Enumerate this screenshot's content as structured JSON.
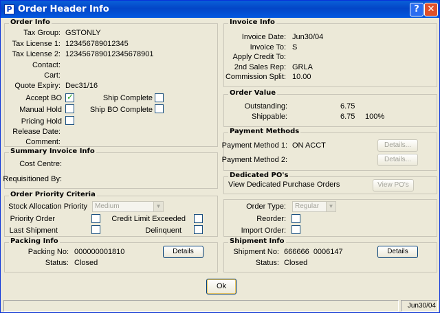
{
  "window": {
    "title": "Order Header Info",
    "app_icon": "P",
    "help_label": "?",
    "close_label": "✕"
  },
  "order_info": {
    "title": "Order Info",
    "tax_group_label": "Tax Group:",
    "tax_group": "GSTONLY",
    "tax_license1_label": "Tax License 1:",
    "tax_license1": "123456789012345",
    "tax_license2_label": "Tax License 2:",
    "tax_license2": "123456789012345678901",
    "contact_label": "Contact:",
    "cart_label": "Cart:",
    "quote_expiry_label": "Quote Expiry:",
    "quote_expiry": "Dec31/16",
    "accept_bo_label": "Accept BO",
    "accept_bo": true,
    "ship_complete_label": "Ship Complete",
    "ship_complete": false,
    "manual_hold_label": "Manual Hold",
    "manual_hold": false,
    "ship_bo_complete_label": "Ship BO Complete",
    "ship_bo_complete": false,
    "pricing_hold_label": "Pricing Hold",
    "pricing_hold": false,
    "release_date_label": "Release Date:",
    "comment_label": "Comment:"
  },
  "summary_invoice": {
    "title": "Summary Invoice Info",
    "cost_centre_label": "Cost Centre:",
    "requisitioned_label": "Requisitioned By:"
  },
  "priority": {
    "title": "Order Priority Criteria",
    "stock_alloc_label": "Stock Allocation Priority",
    "stock_alloc_value": "Medium",
    "priority_order_label": "Priority Order",
    "credit_limit_label": "Credit Limit Exceeded",
    "last_shipment_label": "Last Shipment",
    "delinquent_label": "Delinquent"
  },
  "packing": {
    "title": "Packing Info",
    "packing_no_label": "Packing No:",
    "packing_no": "000000001810",
    "status_label": "Status:",
    "status": "Closed",
    "details_label": "Details"
  },
  "invoice_info": {
    "title": "Invoice Info",
    "invoice_date_label": "Invoice Date:",
    "invoice_date": "Jun30/04",
    "invoice_to_label": "Invoice To:",
    "invoice_to": "S",
    "apply_credit_label": "Apply Credit To:",
    "sales_rep_label": "2nd Sales Rep:",
    "sales_rep": "GRLA",
    "commission_label": "Commission Split:",
    "commission": "10.00"
  },
  "order_value": {
    "title": "Order Value",
    "outstanding_label": "Outstanding:",
    "outstanding": "6.75",
    "shippable_label": "Shippable:",
    "shippable": "6.75",
    "shippable_pct": "100%"
  },
  "payment": {
    "title": "Payment Methods",
    "method1_label": "Payment Method 1:",
    "method1": "ON ACCT",
    "method2_label": "Payment Method 2:",
    "details_label": "Details..."
  },
  "dedicated_po": {
    "title": "Dedicated PO's",
    "view_text": "View Dedicated Purchase Orders",
    "view_button": "View PO's"
  },
  "order_type": {
    "type_label": "Order Type:",
    "type_value": "Regular",
    "reorder_label": "Reorder:",
    "import_label": "Import Order:"
  },
  "shipment": {
    "title": "Shipment Info",
    "shipment_no_label": "Shipment No:",
    "shipment_no": "666666  0006147",
    "status_label": "Status:",
    "status": "Closed",
    "details_label": "Details"
  },
  "ok_label": "Ok",
  "statusbar": {
    "date": "Jun30/04"
  }
}
